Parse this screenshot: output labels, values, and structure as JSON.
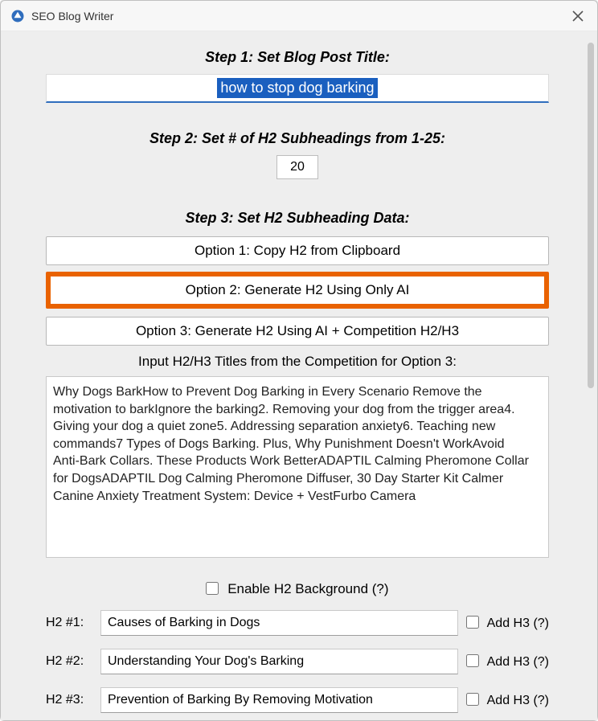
{
  "window": {
    "title": "SEO Blog Writer"
  },
  "step1": {
    "label": "Step 1: Set Blog Post Title:",
    "title_value": "how to stop dog barking"
  },
  "step2": {
    "label": "Step 2: Set # of H2 Subheadings from 1-25:",
    "value": "20"
  },
  "step3": {
    "label": "Step 3: Set H2 Subheading Data:",
    "option1": "Option 1: Copy H2 from Clipboard",
    "option2": "Option 2: Generate H2 Using Only AI",
    "option3": "Option 3: Generate H2 Using AI + Competition H2/H3",
    "competition_label": "Input H2/H3 Titles from the Competition for Option 3:",
    "competition_text": "Why Dogs BarkHow to Prevent Dog Barking in Every Scenario Remove the motivation to barkIgnore the barking2. Removing your dog from the trigger area4. Giving your dog a quiet zone5. Addressing separation anxiety6. Teaching new commands7 Types of Dogs Barking. Plus, Why Punishment Doesn't WorkAvoid Anti-Bark Collars. These Products Work BetterADAPTIL Calming Pheromone Collar for DogsADAPTIL Dog Calming Pheromone Diffuser, 30 Day Starter Kit Calmer Canine Anxiety Treatment System: Device + VestFurbo Camera"
  },
  "enable_bg": {
    "label": "Enable H2 Background (?)"
  },
  "add_h3_label": "Add H3 (?)",
  "h2_rows": [
    {
      "label": "H2 #1:",
      "value": "Causes of Barking in Dogs"
    },
    {
      "label": "H2 #2:",
      "value": "Understanding Your Dog's Barking"
    },
    {
      "label": "H2 #3:",
      "value": "Prevention of Barking By Removing Motivation"
    }
  ]
}
